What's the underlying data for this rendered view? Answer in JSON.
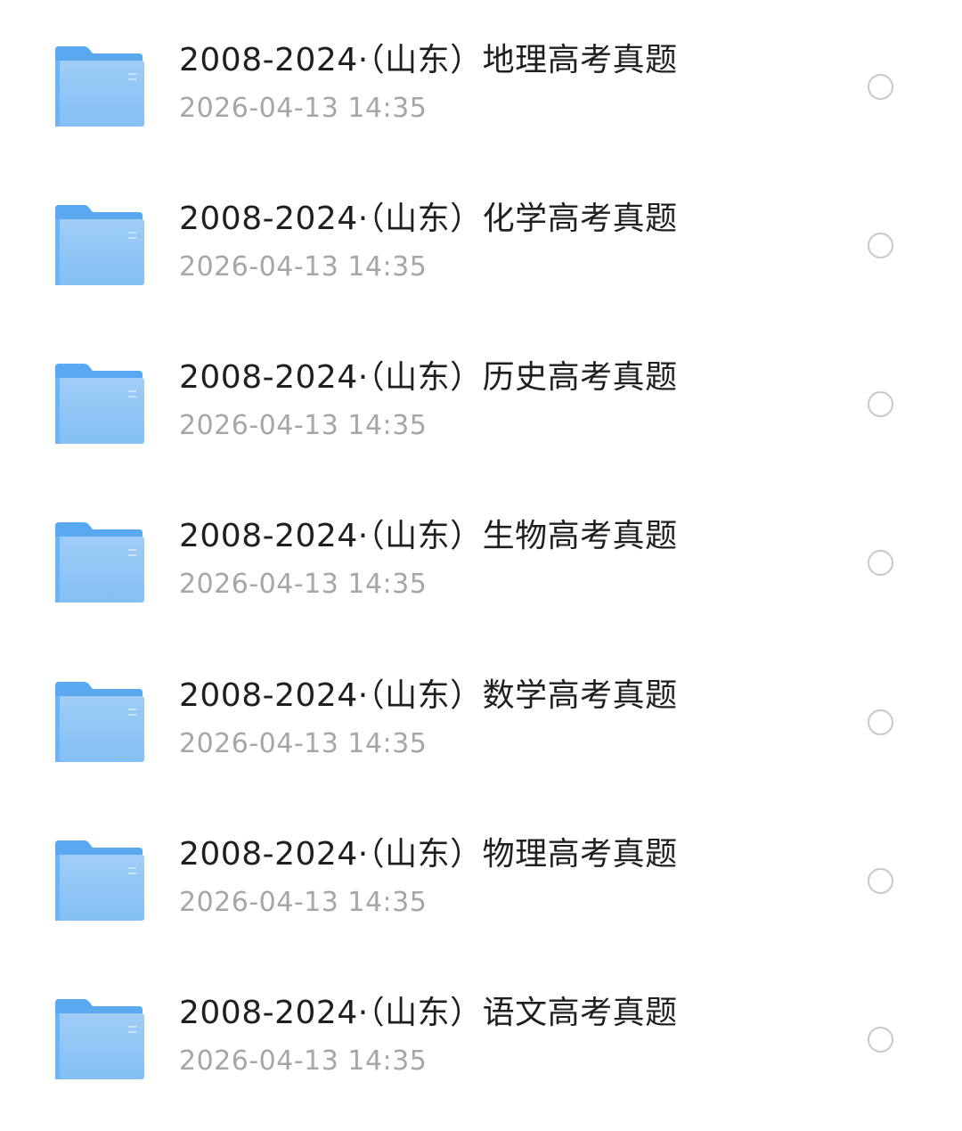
{
  "folders": [
    {
      "name": "2008-2024·（山东）地理高考真题",
      "modified": "2026-04-13 14:35",
      "selected": false,
      "icon": "folder-icon"
    },
    {
      "name": "2008-2024·（山东）化学高考真题",
      "modified": "2026-04-13 14:35",
      "selected": false,
      "icon": "folder-icon"
    },
    {
      "name": "2008-2024·（山东）历史高考真题",
      "modified": "2026-04-13 14:35",
      "selected": false,
      "icon": "folder-icon"
    },
    {
      "name": "2008-2024·（山东）生物高考真题",
      "modified": "2026-04-13 14:35",
      "selected": false,
      "icon": "folder-icon"
    },
    {
      "name": "2008-2024·（山东）数学高考真题",
      "modified": "2026-04-13 14:35",
      "selected": false,
      "icon": "folder-icon"
    },
    {
      "name": "2008-2024·（山东）物理高考真题",
      "modified": "2026-04-13 14:35",
      "selected": false,
      "icon": "folder-icon"
    },
    {
      "name": "2008-2024·（山东）语文高考真题",
      "modified": "2026-04-13 14:35",
      "selected": false,
      "icon": "folder-icon"
    }
  ],
  "colors": {
    "folder_back": "#5aa8f0",
    "folder_front_top": "#9fcdf7",
    "folder_front_bottom": "#7ab9f4",
    "title_text": "#1f1f1f",
    "date_text": "#a6a6a6",
    "radio_border": "#c8c8c8"
  }
}
